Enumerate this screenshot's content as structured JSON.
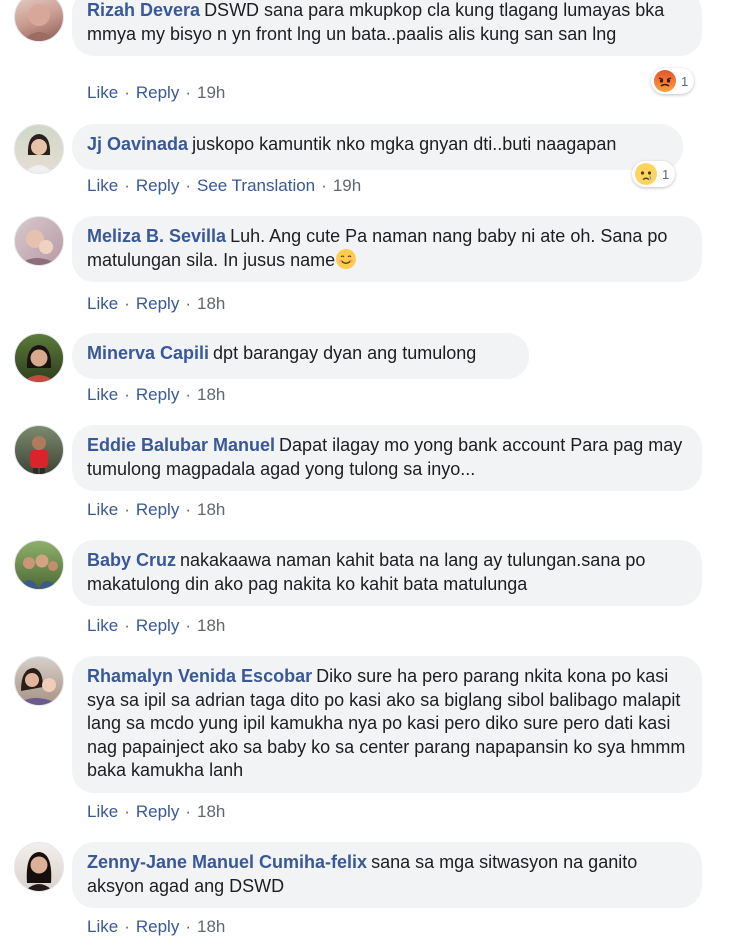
{
  "comments": [
    {
      "name": "Rizah Devera",
      "text": "DSWD sana para mkupkop cla kung tlagang lumayas bka mmya my bisyo n yn front lng un bata..paalis alis kung san san lng",
      "like": "Like",
      "reply": "Reply",
      "time": "19h",
      "reaction": {
        "icon": "angry-reaction-icon",
        "count": "1"
      }
    },
    {
      "name": "Jj Oavinada",
      "text": "juskopo kamuntik nko mgka gnyan dti..buti naagapan",
      "like": "Like",
      "reply": "Reply",
      "translate": "See Translation",
      "time": "19h",
      "reaction": {
        "icon": "sad-reaction-icon",
        "count": "1"
      }
    },
    {
      "name": "Meliza B. Sevilla",
      "text": "Luh. Ang cute Pa naman nang baby ni ate oh. Sana po matulungan sila. In jusus name",
      "emoji": "smiling-face-emoji",
      "like": "Like",
      "reply": "Reply",
      "time": "18h"
    },
    {
      "name": "Minerva Capili",
      "text": "dpt barangay dyan ang tumulong",
      "like": "Like",
      "reply": "Reply",
      "time": "18h"
    },
    {
      "name": "Eddie Balubar Manuel",
      "text": "Dapat ilagay mo yong bank account Para pag may tumulong magpadala agad yong tulong sa inyo...",
      "like": "Like",
      "reply": "Reply",
      "time": "18h"
    },
    {
      "name": "Baby Cruz",
      "text": "nakakaawa naman kahit bata na lang ay tulungan.sana po makatulong din ako pag nakita ko kahit bata matulunga",
      "like": "Like",
      "reply": "Reply",
      "time": "18h"
    },
    {
      "name": "Rhamalyn Venida Escobar",
      "text": "Diko sure ha pero parang nkita kona po kasi sya sa ipil sa adrian taga dito po kasi ako sa biglang sibol balibago malapit lang sa mcdo yung ipil kamukha nya po kasi pero diko sure pero dati kasi nag papainject ako sa baby ko sa center parang napapansin ko sya hmmm baka kamukha lanh",
      "like": "Like",
      "reply": "Reply",
      "time": "18h"
    },
    {
      "name": "Zenny-Jane Manuel Cumiha-felix",
      "text": "sana sa mga sitwasyon na ganito aksyon agad ang DSWD",
      "like": "Like",
      "reply": "Reply",
      "time": "18h"
    }
  ],
  "colors": {
    "name": "#385898",
    "link": "#385898",
    "bubble": "#f2f3f5",
    "angry": "#f0703b",
    "sad_emoji": "#ffcc4d"
  }
}
